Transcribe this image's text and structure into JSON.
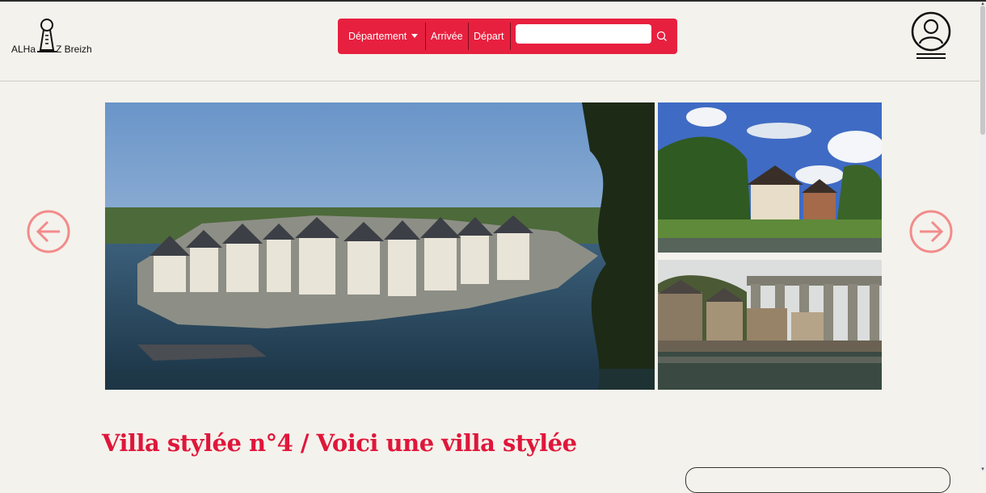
{
  "header": {
    "logo_left": "ALHa",
    "logo_right": "Z Breizh",
    "search": {
      "department_label": "Département",
      "arrival_label": "Arrivée",
      "departure_label": "Départ",
      "input_value": "",
      "input_placeholder": ""
    }
  },
  "gallery": {
    "images": [
      "harbour-town-photo",
      "manor-house-photo",
      "viaduct-town-photo"
    ]
  },
  "listing": {
    "title": "Villa stylée n°4 / Voici une villa stylée"
  },
  "colors": {
    "accent": "#e8203f",
    "background": "#f4f2ec",
    "arrow": "#f28b8b"
  }
}
